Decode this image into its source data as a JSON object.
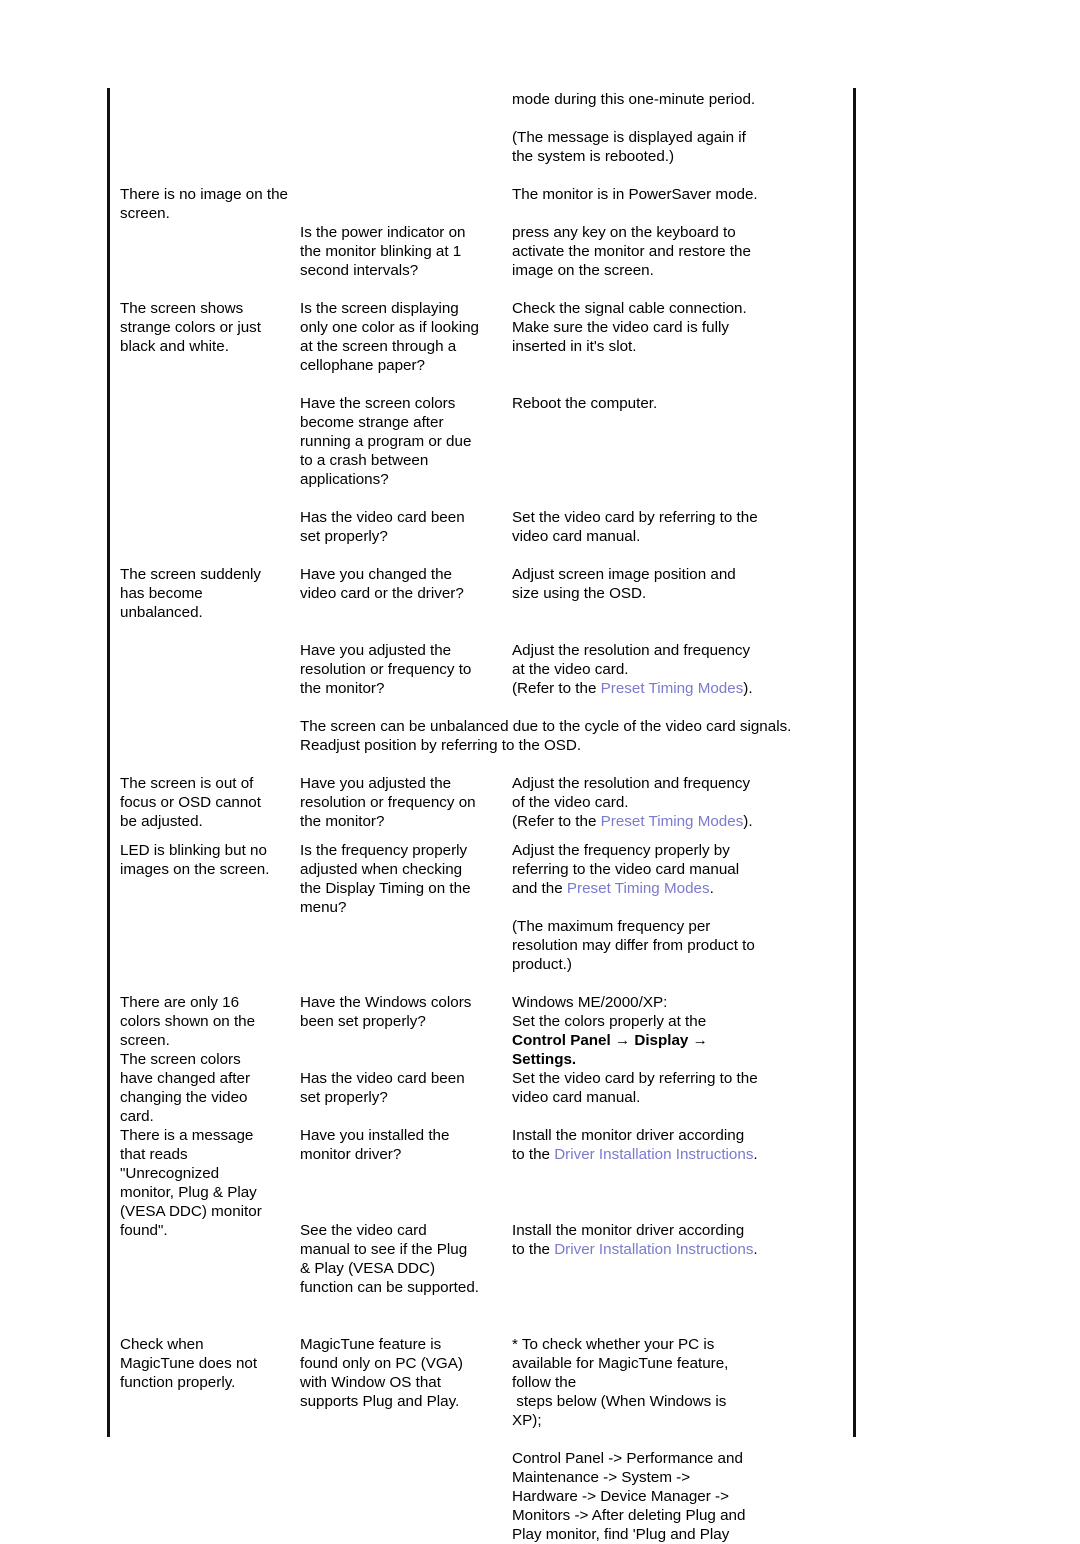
{
  "document": {
    "type": "troubleshooting-table",
    "link_color": "#7a7ace",
    "text_color": "#000000",
    "background_color": "#ffffff"
  },
  "rows": [
    {
      "id": "row-powersaver-continued",
      "symptom": "",
      "check": "",
      "solution_blocks": [
        "mode during this one-minute period.",
        "(The message is displayed again if\nthe system is rebooted.)"
      ]
    },
    {
      "id": "row-no-image",
      "symptom": "There is no image on the\nscreen.",
      "check": "",
      "solution": "The monitor is in PowerSaver mode."
    },
    {
      "id": "row-power-indicator",
      "symptom": "",
      "check": "Is the power indicator on\nthe monitor blinking at 1\nsecond intervals?",
      "solution": "press any key on the keyboard to\nactivate the monitor and restore the\nimage on the screen."
    },
    {
      "id": "row-strange-colors",
      "symptom": "The screen shows\nstrange colors or just\nblack and white.",
      "check": "Is the screen displaying\nonly one color as if looking\nat the screen through a\ncellophane paper?",
      "solution": "Check the signal cable connection.\nMake sure the video card is fully\ninserted in it's slot."
    },
    {
      "id": "row-colors-strange-after-program",
      "symptom": "",
      "check": "Have the screen colors\nbecome strange after\nrunning a program or due\nto a crash between\napplications?",
      "solution": "Reboot the computer."
    },
    {
      "id": "row-video-card-set-1",
      "symptom": "",
      "check": "Has the video card been\nset properly?",
      "solution": "Set the video card by referring to the\nvideo card manual."
    },
    {
      "id": "row-screen-unbalanced",
      "symptom": "The screen suddenly\nhas become\nunbalanced.",
      "check": "Have you changed the\nvideo card or the driver?",
      "solution": "Adjust screen image position and\nsize using the OSD."
    },
    {
      "id": "row-resolution-frequency-1",
      "symptom": "",
      "check": "Have you adjusted the\nresolution or frequency to\nthe monitor?",
      "solution_rich": {
        "lines": [
          "Adjust the resolution and frequency",
          "at the video card."
        ],
        "link_line": {
          "prefix": "(Refer to the ",
          "link": "Preset Timing Modes",
          "suffix": ")."
        }
      }
    },
    {
      "id": "row-unbalanced-note",
      "note": "The screen can be unbalanced due to the cycle of the video card signals.\nReadjust position by referring to the OSD."
    },
    {
      "id": "row-out-of-focus",
      "symptom": "The screen is out of\nfocus or OSD cannot\nbe adjusted.",
      "check": "Have you adjusted the\nresolution or frequency on\nthe monitor?",
      "solution_rich": {
        "lines": [
          "Adjust the resolution and frequency",
          "of the video card."
        ],
        "link_line": {
          "prefix": "(Refer to the ",
          "link": "Preset Timing Modes",
          "suffix": ")."
        }
      }
    },
    {
      "id": "row-led-blinking",
      "symptom": "LED is blinking but no\nimages on the screen.",
      "check": "Is the frequency properly\nadjusted when checking\nthe Display Timing on the\nmenu?",
      "solution_rich": {
        "lines": [
          "Adjust the frequency properly by",
          "referring to the video card manual"
        ],
        "link_line": {
          "prefix": "and the ",
          "link": "Preset Timing Modes",
          "suffix": "."
        },
        "after": "(The maximum frequency per\nresolution may differ from product to\nproduct.)"
      }
    },
    {
      "id": "row-16-colors",
      "symptom": "There are only 16\ncolors shown on the\nscreen.\nThe screen colors\nhave changed after\nchanging the video\ncard.",
      "check": "Have the Windows colors\nbeen set properly?",
      "solution_rich": {
        "lines": [
          "Windows ME/2000/XP:",
          "Set the colors properly at the"
        ],
        "bold_lines": [
          "Control Panel → Display →",
          "Settings."
        ]
      }
    },
    {
      "id": "row-video-card-set-2",
      "symptom": "",
      "check": "Has the video card been\nset properly?",
      "solution": "Set the video card by referring to the\nvideo card manual."
    },
    {
      "id": "row-unrecognized-monitor",
      "symptom": "There is a message\nthat reads\n\"Unrecognized\nmonitor, Plug & Play\n(VESA DDC) monitor\nfound\".",
      "check": "Have you installed the\nmonitor driver?",
      "solution_rich": {
        "lines": [
          "Install the monitor driver according"
        ],
        "link_line": {
          "prefix": "to the ",
          "link": "Driver Installation Instructions",
          "suffix": "."
        }
      }
    },
    {
      "id": "row-vesa-ddc",
      "symptom": "",
      "check": "See the video card\nmanual to see if the Plug\n& Play (VESA DDC)\nfunction can be supported.",
      "solution_rich": {
        "lines": [
          "Install the monitor driver according"
        ],
        "link_line": {
          "prefix": "to the ",
          "link": "Driver Installation Instructions",
          "suffix": "."
        }
      }
    },
    {
      "id": "row-magictune",
      "symptom": "Check when\nMagicTune does not\nfunction properly.",
      "check": "MagicTune feature is\nfound only on PC (VGA)\nwith Window OS that\nsupports Plug and Play.",
      "solution_blocks": [
        "* To check whether your PC is\navailable for MagicTune feature,\nfollow the\n steps below (When Windows is\nXP);",
        "Control Panel -> Performance and\nMaintenance -> System ->\nHardware -> Device Manager ->\nMonitors -> After deleting Plug and\nPlay monitor, find 'Plug and Play"
      ]
    }
  ]
}
